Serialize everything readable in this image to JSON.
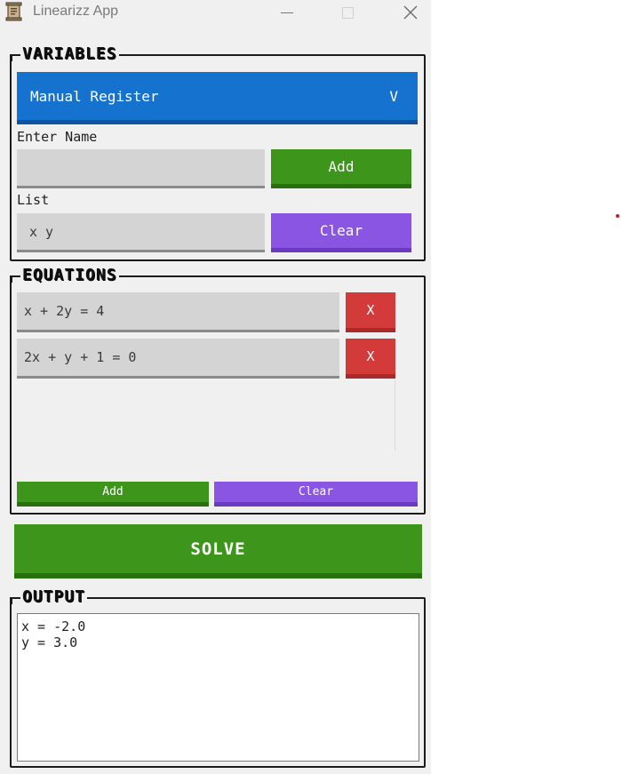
{
  "window": {
    "title": "Linearizz App",
    "controls": {
      "minimize": "—",
      "maximize": "☐",
      "close": "✕"
    },
    "icon": "scroll-app-icon"
  },
  "variables": {
    "title": "VARIABLES",
    "mode": {
      "selected": "Manual Register",
      "chevron": "V"
    },
    "name_label": "Enter Name",
    "name_value": "",
    "add_label": "Add",
    "list_label": "List",
    "list_value": "x y",
    "clear_label": "Clear"
  },
  "equations": {
    "title": "EQUATIONS",
    "items": [
      {
        "text": "x + 2y = 4",
        "remove": "X"
      },
      {
        "text": "2x + y + 1 = 0",
        "remove": "X"
      }
    ],
    "add_label": "Add",
    "clear_label": "Clear"
  },
  "solve_label": "SOLVE",
  "output": {
    "title": "OUTPUT",
    "lines": [
      "x = -2.0",
      "y = 3.0"
    ]
  },
  "colors": {
    "green": "#3d961b",
    "purple": "#8a55e3",
    "red": "#d33b3b",
    "blue": "#1672cf"
  }
}
